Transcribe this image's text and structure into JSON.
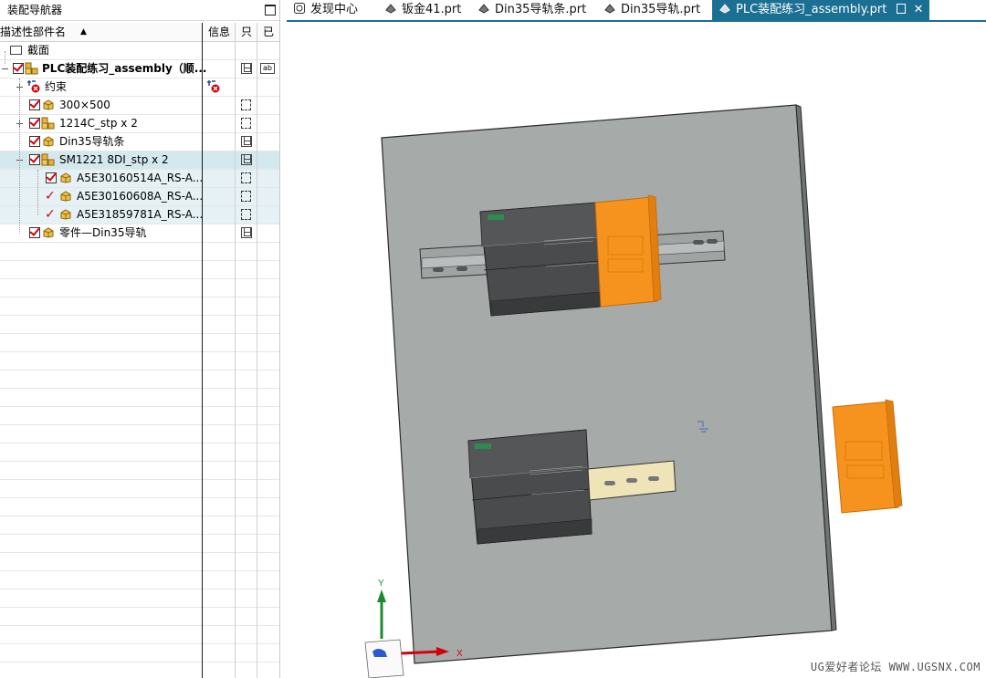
{
  "navigator": {
    "title": "装配导航器",
    "columns": {
      "name": "描述性部件名",
      "sort_arrow": "▲",
      "info": "信息",
      "readonly": "只",
      "modified": "已"
    },
    "rows": [
      {
        "label": "截面"
      },
      {
        "label": "PLC装配练习_assembly（顺..."
      },
      {
        "label": "约束"
      },
      {
        "label": "300×500"
      },
      {
        "label": "1214C_stp x 2"
      },
      {
        "label": "Din35导轨条"
      },
      {
        "label": "SM1221 8DI_stp x 2"
      },
      {
        "label": "A5E30160514A_RS-A..."
      },
      {
        "label": "A5E30160608A_RS-A..."
      },
      {
        "label": "A5E31859781A_RS-A..."
      },
      {
        "label": "零件—Din35导轨"
      }
    ]
  },
  "tabs": [
    {
      "label": "发现中心"
    },
    {
      "label": "钣金41.prt"
    },
    {
      "label": "Din35导轨条.prt"
    },
    {
      "label": "Din35导轨.prt"
    },
    {
      "label": "PLC装配练习_assembly.prt"
    }
  ],
  "viewport": {
    "axis_y": "Y",
    "axis_x": "X",
    "watermark": "UG爱好者论坛 WWW.UGSNX.COM"
  },
  "colors": {
    "tab_active": "#1b6f92",
    "selection": "#d4e9ee",
    "check": "#d4000f",
    "orange": "#f5931e",
    "plate": "#a6aaa8"
  }
}
